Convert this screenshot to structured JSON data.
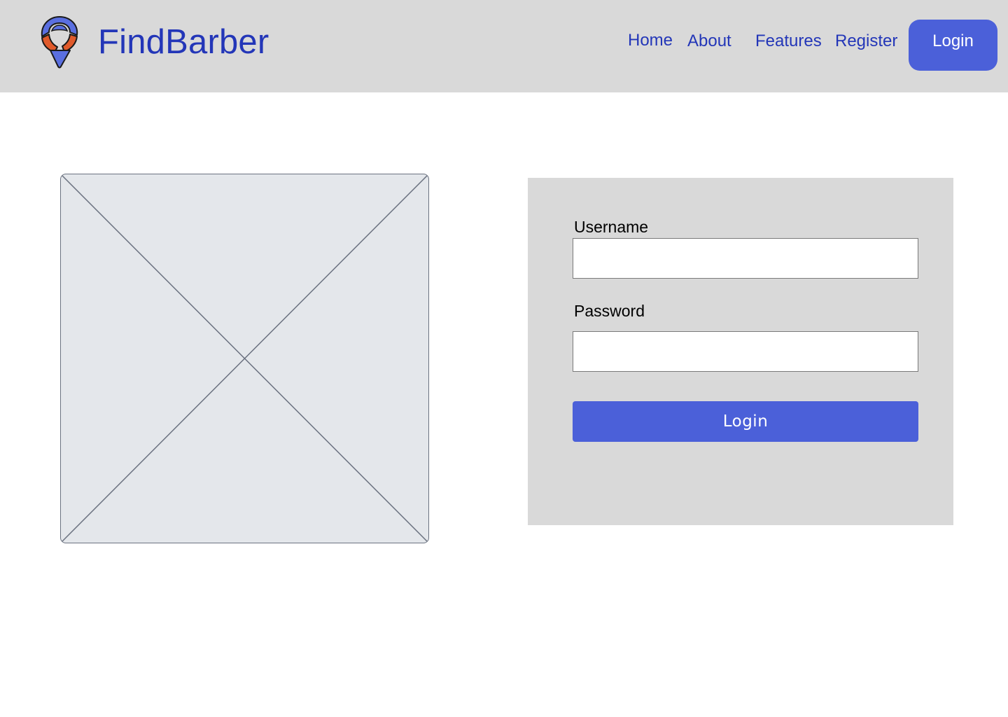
{
  "header": {
    "brand_name": "FindBarber",
    "logo_icon": "map-pin-icon",
    "nav": {
      "home": "Home",
      "about": "About",
      "features": "Features",
      "register": "Register"
    },
    "login_button": "Login"
  },
  "main": {
    "image_placeholder_icon": "image-placeholder-icon",
    "login_form": {
      "username_label": "Username",
      "username_value": "",
      "password_label": "Password",
      "password_value": "",
      "submit_label": "Login"
    }
  },
  "colors": {
    "header_bg": "#d9d9d9",
    "brand_text": "#2336b8",
    "primary_button": "#4b60d9",
    "logo_blue": "#5a6fe0",
    "logo_orange": "#e05a2b",
    "placeholder_bg": "#e4e7eb",
    "panel_bg": "#d9d9d9"
  }
}
